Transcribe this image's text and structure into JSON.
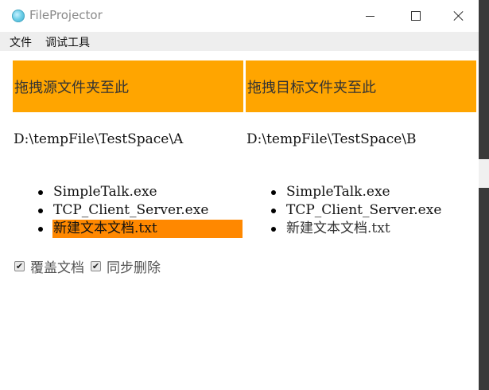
{
  "window": {
    "title": "FileProjector",
    "app_icon": "electron-app-icon",
    "controls": {
      "minimize": "minimize-icon",
      "maximize": "maximize-icon",
      "close": "close-icon"
    }
  },
  "menu": {
    "file": "文件",
    "debug_tools": "调试工具"
  },
  "source": {
    "drop_label": "拖拽源文件夹至此",
    "path": "D:\\tempFile\\TestSpace\\A",
    "files": [
      "SimpleTalk.exe",
      "TCP_Client_Server.exe",
      "新建文本文档.txt"
    ],
    "selected_index": 2
  },
  "target": {
    "drop_label": "拖拽目标文件夹至此",
    "path": "D:\\tempFile\\TestSpace\\B",
    "files": [
      "SimpleTalk.exe",
      "TCP_Client_Server.exe",
      "新建文本文档.txt"
    ]
  },
  "options": {
    "overwrite": {
      "label": "覆盖文档",
      "checked": true
    },
    "sync_delete": {
      "label": "同步删除",
      "checked": true
    }
  },
  "colors": {
    "drop_zone": "#ffa500",
    "selected_item": "#ff8800",
    "menubar": "#eeeeee"
  }
}
